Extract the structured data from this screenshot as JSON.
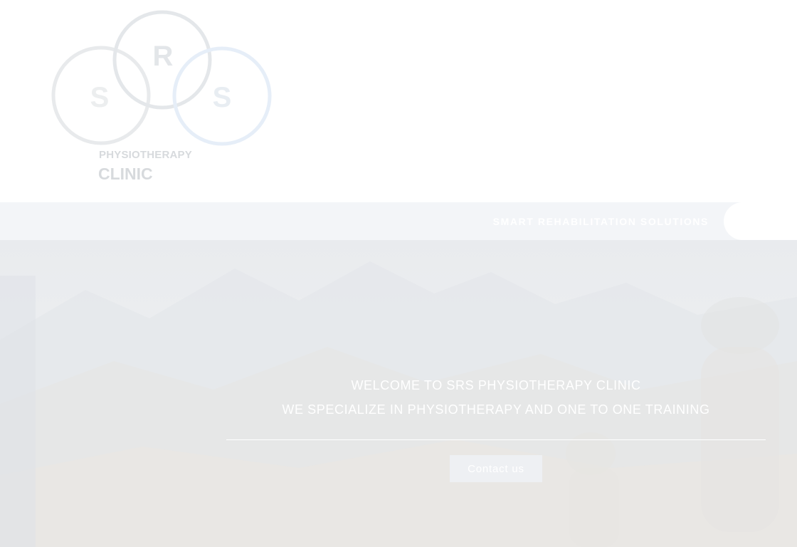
{
  "logo": {
    "icon": "srs-three-circles-logo",
    "letters": [
      "S",
      "R",
      "S"
    ],
    "line1": "PHYSIOTHERAPY",
    "line2": "CLINIC"
  },
  "tagline": "SMART REHABILITATION SOLUTIONS",
  "hero": {
    "line1": "WELCOME TO SRS PHYSIOTHERAPY CLINIC",
    "line2": "WE SPECIALIZE IN PHYSIOTHERAPY AND ONE TO ONE TRAINING",
    "button_label": "Contact us",
    "background": "mountain-landscape-image"
  },
  "colors": {
    "logo_ring": "#e4e7ea",
    "logo_ring_accent": "#e6eef8",
    "tagbar": "#f3f5f8",
    "text_light": "#ffffff"
  }
}
